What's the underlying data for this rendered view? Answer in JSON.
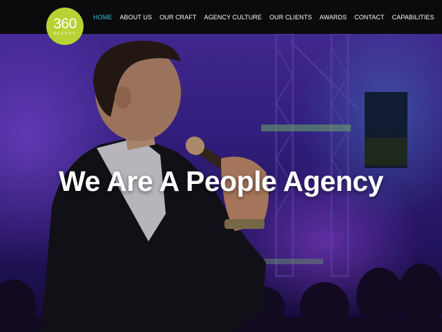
{
  "logo": {
    "number": "360",
    "word": "AGENCY"
  },
  "nav": {
    "items": [
      {
        "label": "HOME",
        "active": true
      },
      {
        "label": "ABOUT US",
        "active": false
      },
      {
        "label": "OUR CRAFT",
        "active": false
      },
      {
        "label": "AGENCY CULTURE",
        "active": false
      },
      {
        "label": "OUR CLIENTS",
        "active": false
      },
      {
        "label": "AWARDS",
        "active": false
      },
      {
        "label": "CONTACT",
        "active": false
      },
      {
        "label": "CAPABILITIES",
        "active": false
      }
    ]
  },
  "hero": {
    "title": "We Are A People Agency"
  },
  "colors": {
    "accent": "#2ec4d6",
    "logo_bg": "#b7d334",
    "header_bg": "#0b0b0d",
    "stage_purple": "#3a2390"
  }
}
